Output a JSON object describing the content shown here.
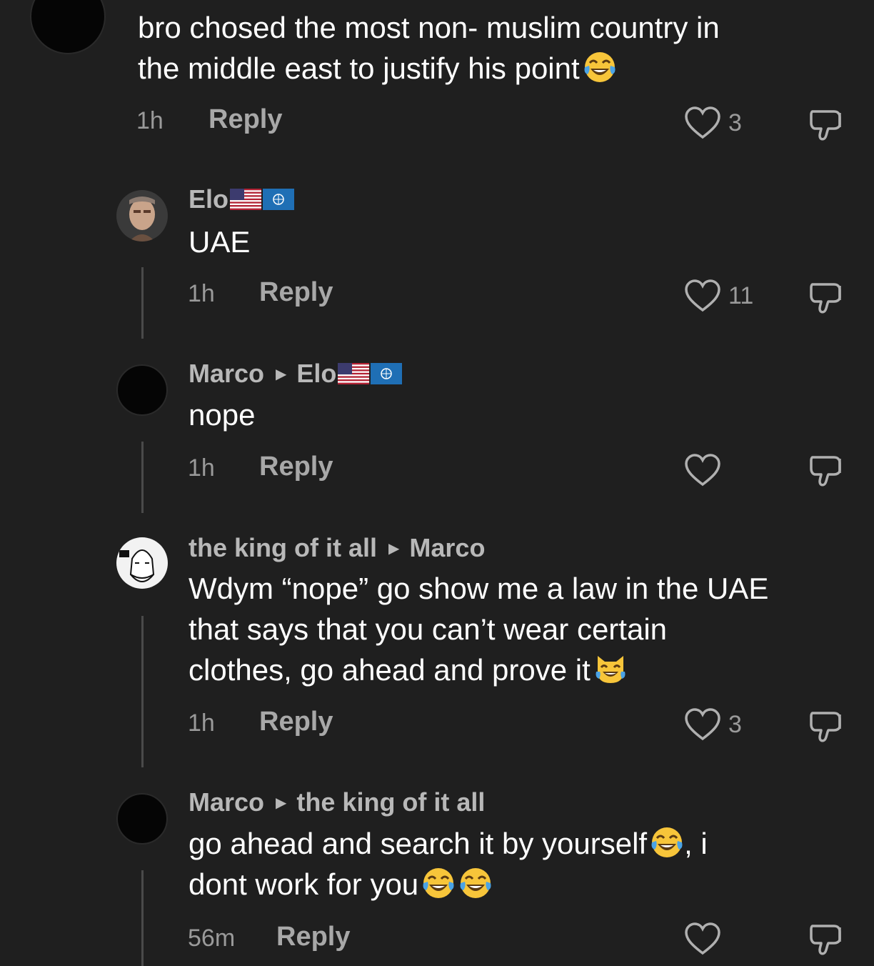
{
  "comments": [
    {
      "author": "",
      "text_lines": [
        "bro chosed the most non- muslim country in",
        "the middle east to justify his point"
      ],
      "time": "1h",
      "reply_label": "Reply",
      "likes": "3"
    },
    {
      "author": "Elo",
      "text_lines": [
        "UAE"
      ],
      "time": "1h",
      "reply_label": "Reply",
      "likes": "11"
    },
    {
      "author": "Marco",
      "reply_to": "Elo",
      "text_lines": [
        "nope"
      ],
      "time": "1h",
      "reply_label": "Reply",
      "likes": ""
    },
    {
      "author": "the king of it all",
      "reply_to": "Marco",
      "text_lines": [
        "Wdym “nope” go show me a law in the UAE",
        "that says that you can’t wear certain",
        "clothes, go ahead and prove it"
      ],
      "time": "1h",
      "reply_label": "Reply",
      "likes": "3"
    },
    {
      "author": "Marco",
      "reply_to": "the king of it all",
      "text_lines": [
        "go ahead and search it by yourself",
        "dont work for you"
      ],
      "text_suffix": ", i",
      "time": "56m",
      "reply_label": "Reply",
      "likes": ""
    }
  ],
  "icons": {
    "like": "heart-outline-icon",
    "dislike": "thumbs-down-icon",
    "reply_arrow": "triangle-right-icon",
    "laugh": "face-with-tears-of-joy-emoji",
    "cat_laugh": "grinning-cat-emoji"
  },
  "colors": {
    "background": "#1f1f1f",
    "author": "#b8b8b8",
    "meta": "#9a9a9a"
  }
}
